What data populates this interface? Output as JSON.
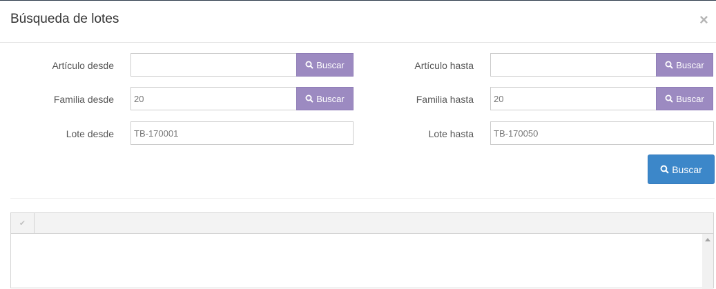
{
  "modal": {
    "title": "Búsqueda de lotes",
    "close_glyph": "×"
  },
  "form": {
    "articulo_desde": {
      "label": "Artículo desde",
      "value": "",
      "button_label": "Buscar"
    },
    "articulo_hasta": {
      "label": "Artículo hasta",
      "value": "",
      "button_label": "Buscar"
    },
    "familia_desde": {
      "label": "Familia desde",
      "value": "20",
      "button_label": "Buscar"
    },
    "familia_hasta": {
      "label": "Familia hasta",
      "value": "20",
      "button_label": "Buscar"
    },
    "lote_desde": {
      "label": "Lote desde",
      "value": "TB-170001"
    },
    "lote_hasta": {
      "label": "Lote hasta",
      "value": "TB-170050"
    },
    "search_button_label": "Buscar"
  },
  "grid": {
    "header_check_glyph": "✔"
  },
  "icons": {
    "search": "search-icon",
    "close": "close-icon",
    "check": "check-icon"
  },
  "colors": {
    "purple_button": "#9c8ac1",
    "primary_button": "#3c87c9"
  }
}
